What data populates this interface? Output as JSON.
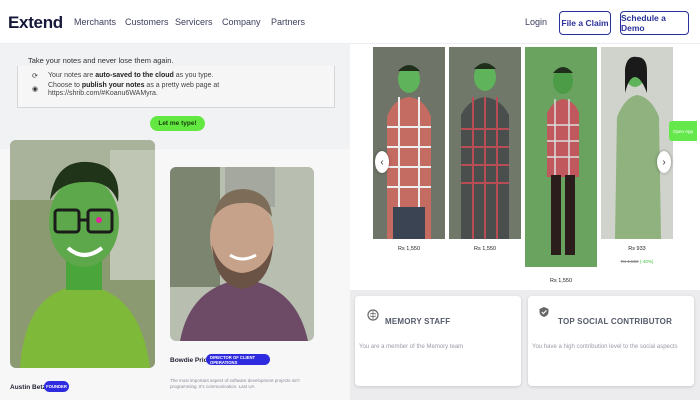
{
  "nav": {
    "logo": "Extend",
    "links": [
      "Merchants",
      "Customers",
      "Servicers",
      "Company",
      "Partners"
    ],
    "login": "Login",
    "file_claim": "File a Claim",
    "schedule_demo": "Schedule a Demo",
    "accent": "#2a3198"
  },
  "notes": {
    "heading": "Take your notes and never lose them again.",
    "line1_pre": "Your notes are ",
    "line1_bold": "auto-saved to the cloud",
    "line1_post": " as you type.",
    "line2_pre": "Choose to ",
    "line2_bold": "publish your notes",
    "line2_post": " as a pretty web page at",
    "line3": "https://shrib.com/#Koanu6WAMyra.",
    "cta": "Let me type!",
    "cta_color": "#62e840"
  },
  "people": [
    {
      "name": "Austin Betzer",
      "role": "FOUNDER"
    },
    {
      "name": "Bowdie Price",
      "role": "DIRECTOR OF CLIENT OPERATIONS",
      "bio1": "The most important aspect of software development projects isn't",
      "bio2": "programming. It's communication. Last UA"
    }
  ],
  "products": {
    "items": [
      {
        "price": "Rs 1,550"
      },
      {
        "price": "Rs 1,550"
      },
      {
        "price": "Rs 1,550"
      },
      {
        "price": "Rs 933",
        "old_price": "Rs 1,550",
        "discount": "(-40%)"
      }
    ],
    "open_app": "Open App",
    "prev_icon": "chevron-left-icon",
    "next_icon": "chevron-right-icon"
  },
  "badges": [
    {
      "title": "MEMORY STAFF",
      "desc": "You are a member of the Memory team",
      "icon": "brain-icon"
    },
    {
      "title": "TOP SOCIAL CONTRIBUTOR",
      "desc": "You have a high contribution level to the social aspects",
      "icon": "shield-check-icon"
    }
  ]
}
